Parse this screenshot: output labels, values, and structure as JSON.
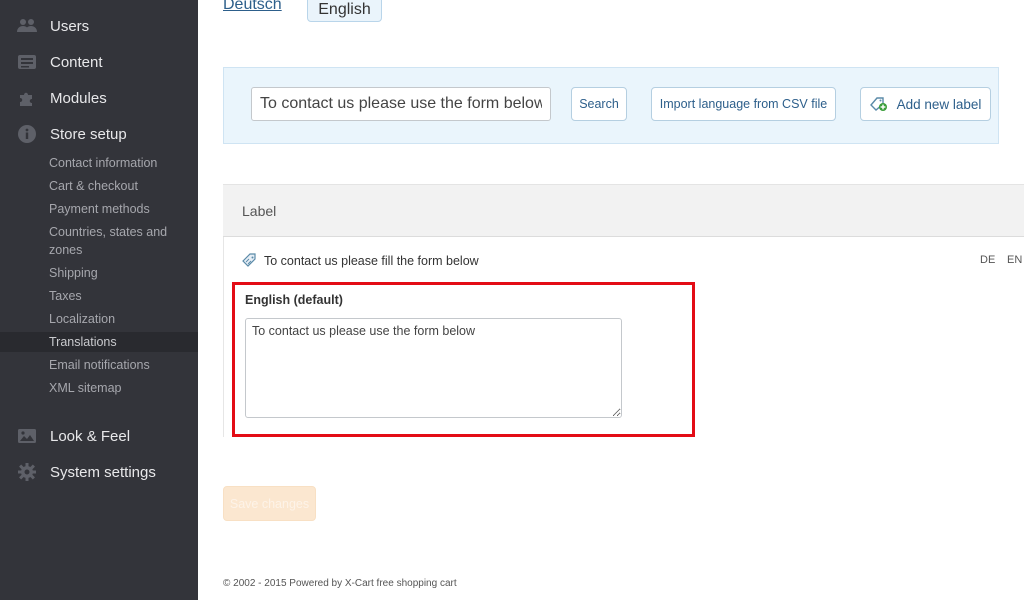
{
  "sidebar": {
    "main_top": [
      {
        "label": "Users",
        "icon": "users-icon"
      },
      {
        "label": "Content",
        "icon": "content-icon"
      },
      {
        "label": "Modules",
        "icon": "puzzle-icon"
      },
      {
        "label": "Store setup",
        "icon": "info-icon"
      }
    ],
    "sub": [
      {
        "label": "Contact information"
      },
      {
        "label": "Cart & checkout"
      },
      {
        "label": "Payment methods"
      },
      {
        "label": "Countries, states and zones"
      },
      {
        "label": "Shipping"
      },
      {
        "label": "Taxes"
      },
      {
        "label": "Localization"
      },
      {
        "label": "Translations",
        "active": true
      },
      {
        "label": "Email notifications"
      },
      {
        "label": "XML sitemap"
      }
    ],
    "main_bottom": [
      {
        "label": "Look & Feel",
        "icon": "image-icon"
      },
      {
        "label": "System settings",
        "icon": "gear-icon"
      }
    ]
  },
  "languages": {
    "deutsch": "Deutsch",
    "english": "English",
    "active": "English"
  },
  "search": {
    "value": "To contact us please use the form below",
    "search_label": "Search",
    "import_label": "Import language from CSV file",
    "add_label": "Add new label"
  },
  "table": {
    "header": "Label",
    "row": {
      "label": "To contact us please fill the form below",
      "codes": [
        "DE",
        "EN"
      ],
      "translation_label": "English (default)",
      "translation_value": "To contact us please use the form below"
    }
  },
  "save_label": "Save changes",
  "footer": "© 2002 - 2015 Powered by X-Cart free shopping cart",
  "colors": {
    "sidebar_bg": "#33343a",
    "highlight": "#e30c16",
    "link": "#2d5f8b"
  }
}
